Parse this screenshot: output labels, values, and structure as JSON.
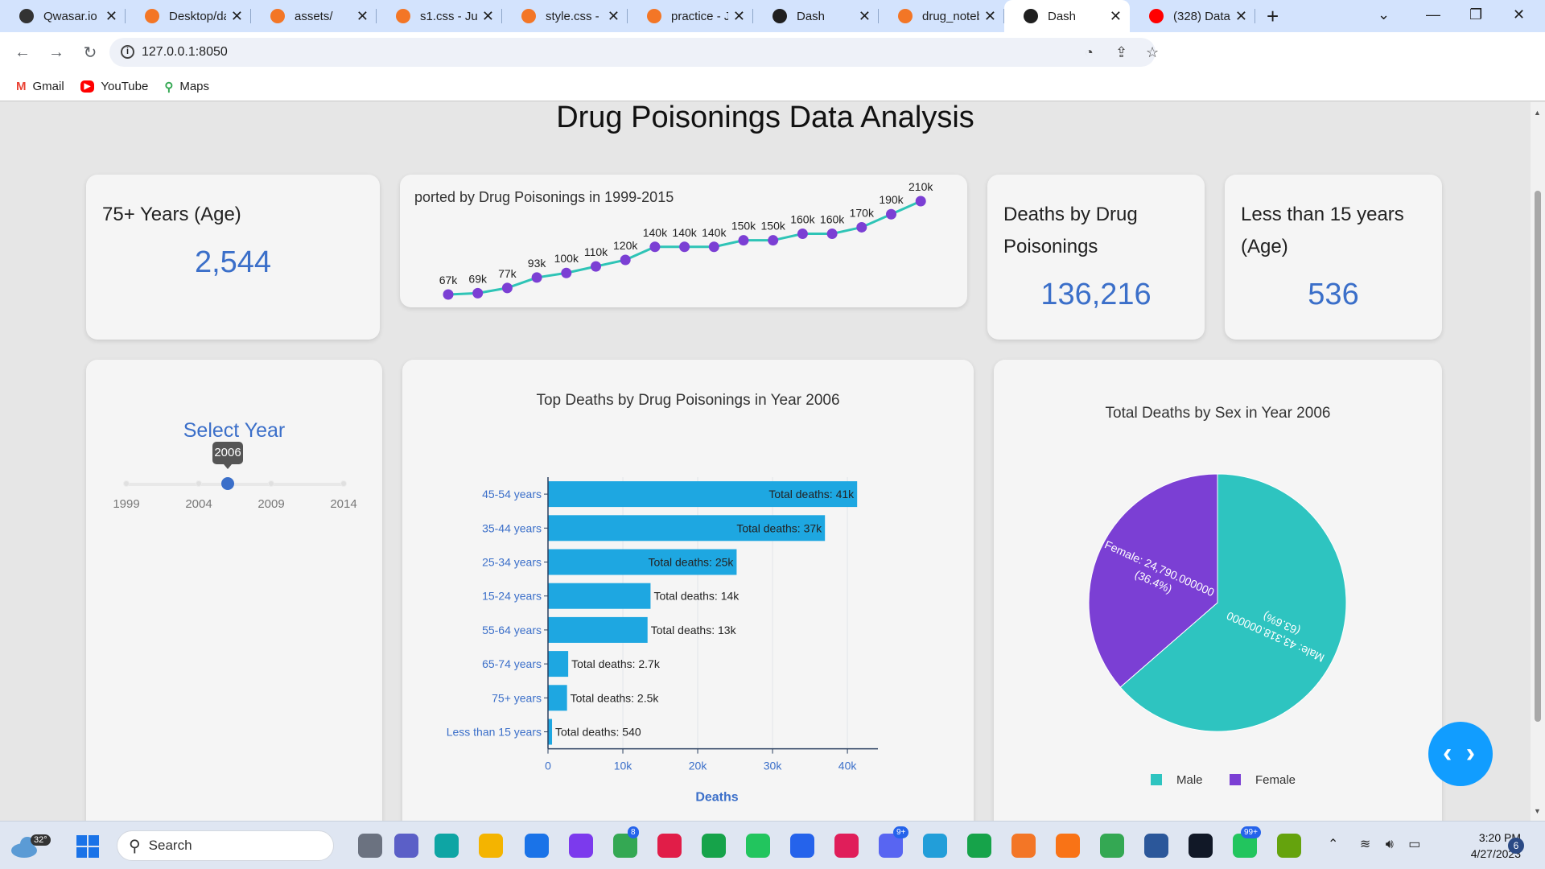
{
  "browser": {
    "tabs": [
      {
        "title": "Qwasar.io -",
        "color": "#333333"
      },
      {
        "title": "Desktop/da",
        "color": "#f37626"
      },
      {
        "title": "assets/",
        "color": "#f37626"
      },
      {
        "title": "s1.css - Jup",
        "color": "#f37626"
      },
      {
        "title": "style.css - Ju",
        "color": "#f37626"
      },
      {
        "title": "practice - Ju",
        "color": "#f37626"
      },
      {
        "title": "Dash",
        "color": "#1f1f1f"
      },
      {
        "title": "drug_noteb",
        "color": "#f37626"
      },
      {
        "title": "Dash",
        "color": "#1f1f1f",
        "active": true
      },
      {
        "title": "(328) Data",
        "color": "#ff0000"
      }
    ],
    "url": "127.0.0.1:8050",
    "bookmarks": [
      "Gmail",
      "YouTube",
      "Maps"
    ]
  },
  "page": {
    "title": "Drug Poisonings Data Analysis"
  },
  "kpis": {
    "age_75": {
      "label": "75+ Years (Age)",
      "value": "2,544"
    },
    "deaths_total": {
      "label_line1": "Deaths by Drug",
      "label_line2": "Poisonings",
      "value": "136,216"
    },
    "under_15": {
      "label_line1": "Less than 15 years",
      "label_line2": "(Age)",
      "value": "536"
    }
  },
  "trend": {
    "title": "ported by Drug Poisonings in 1999-2015",
    "labels": [
      "67k",
      "69k",
      "77k",
      "93k",
      "100k",
      "110k",
      "120k",
      "140k",
      "140k",
      "140k",
      "150k",
      "150k",
      "160k",
      "160k",
      "170k",
      "190k",
      "210k"
    ],
    "values": [
      67,
      69,
      77,
      93,
      100,
      110,
      120,
      140,
      140,
      140,
      150,
      150,
      160,
      160,
      170,
      190,
      210
    ],
    "line_color": "#2ec4b6",
    "marker_color": "#7b3fd4"
  },
  "year_slider": {
    "title": "Select Year",
    "selected": "2006",
    "selected_value": 2006,
    "min": 1999,
    "max": 2014,
    "marks": [
      "1999",
      "2004",
      "2009",
      "2014"
    ],
    "accent": "#3b6fc9"
  },
  "chart_data": [
    {
      "type": "bar",
      "orientation": "horizontal",
      "title": "Top Deaths by Drug Poisonings in Year 2006",
      "categories": [
        "45-54 years",
        "35-44 years",
        "25-34 years",
        "15-24 years",
        "55-64 years",
        "65-74 years",
        "75+ years",
        "Less than 15 years"
      ],
      "values": [
        41300,
        37000,
        25200,
        13700,
        13300,
        2700,
        2544,
        540
      ],
      "data_labels": [
        "Total deaths: 41k",
        "Total deaths: 37k",
        "Total deaths: 25k",
        "Total deaths: 14k",
        "Total deaths: 13k",
        "Total deaths: 2.7k",
        "Total deaths: 2.5k",
        "Total deaths: 540"
      ],
      "xlabel": "Deaths",
      "ylabel": "",
      "xlim": [
        0,
        43000
      ],
      "x_ticks": [
        0,
        10000,
        20000,
        30000,
        40000
      ],
      "x_tick_labels": [
        "0",
        "10k",
        "20k",
        "30k",
        "40k"
      ],
      "grid": true,
      "bar_color": "#1ea7e1"
    },
    {
      "type": "pie",
      "title": "Total Deaths by Sex in Year 2006",
      "labels": [
        "Male",
        "Female"
      ],
      "values": [
        43318,
        24790
      ],
      "slice_text": [
        "Male: 43,318.000000",
        "Female: 24,790.000000"
      ],
      "slice_pct": [
        "(63.6%)",
        "(36.4%)"
      ],
      "colors": [
        "#2ec4c0",
        "#7b3fd4"
      ],
      "legend": "bottom"
    }
  ],
  "taskbar": {
    "weather_temp": "32°",
    "search_label": "Search",
    "time": "3:20 PM",
    "date": "4/27/2023",
    "notifications": "6",
    "badge_chrome": "8",
    "badge_discord": "9+",
    "badge_whatsapp": "99+"
  }
}
